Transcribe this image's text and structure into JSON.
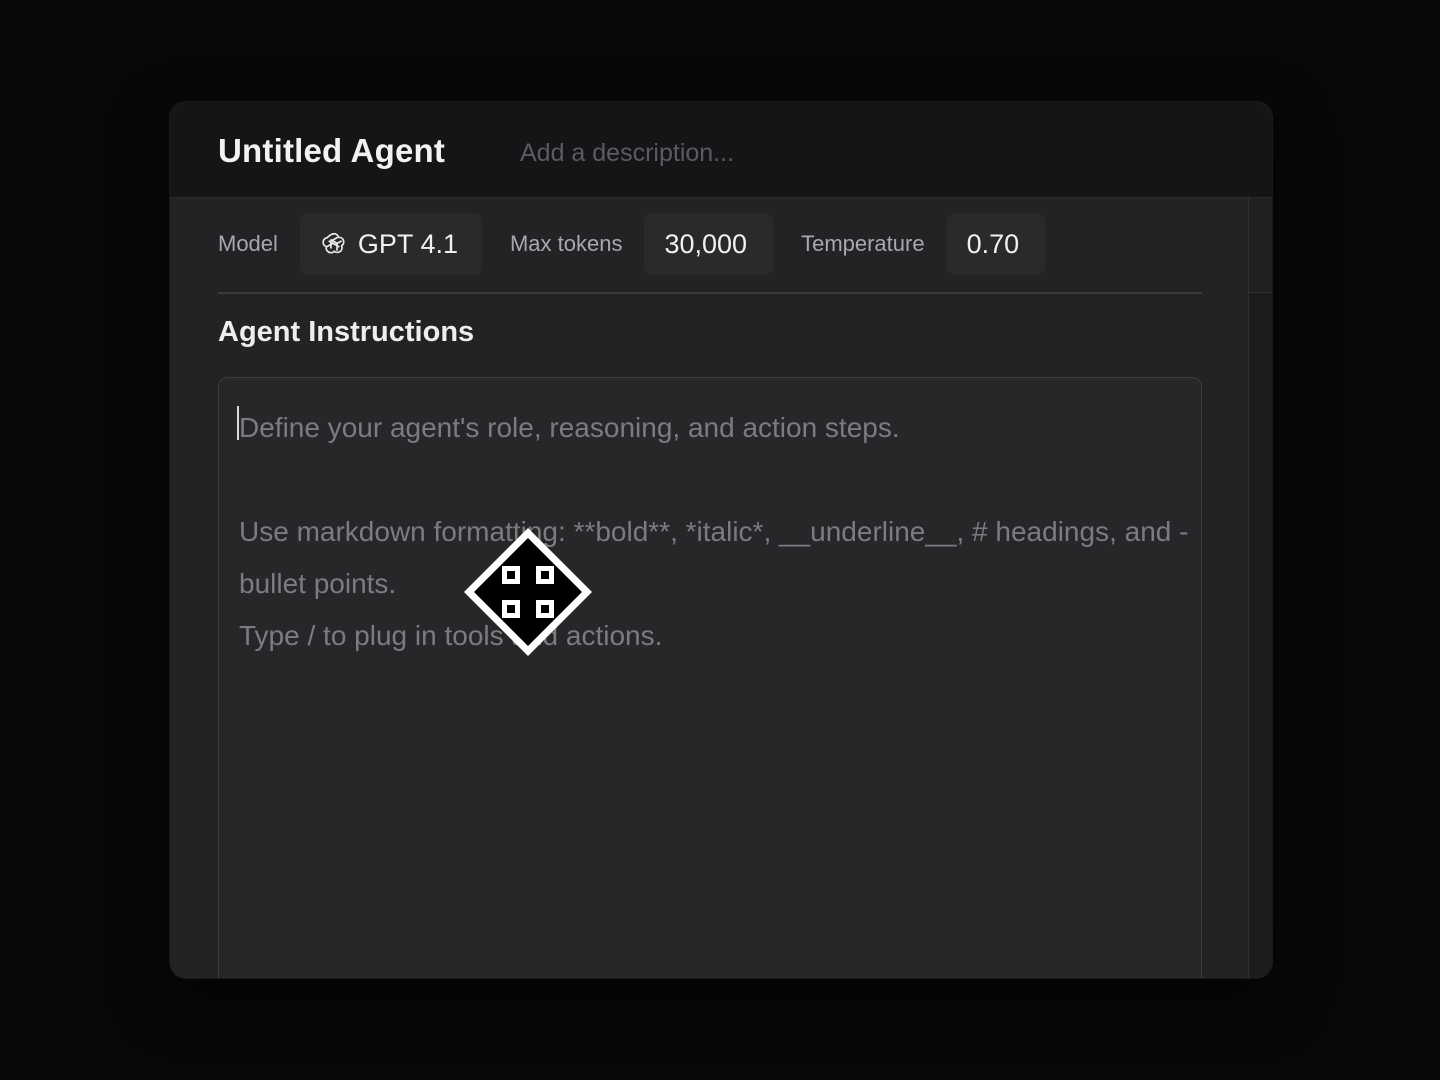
{
  "header": {
    "title": "Untitled Agent",
    "description_placeholder": "Add a description..."
  },
  "config": {
    "model_label": "Model",
    "model_value": "GPT 4.1",
    "model_icon": "openai-logo-icon",
    "max_tokens_label": "Max tokens",
    "max_tokens_value": "30,000",
    "temperature_label": "Temperature",
    "temperature_value": "0.70"
  },
  "instructions": {
    "title": "Agent Instructions",
    "placeholder_line1": "Define your agent's role, reasoning, and action steps.",
    "placeholder_line2": "Use markdown formatting: **bold**, *italic*, __underline__, # headings, and - bullet points.",
    "placeholder_line3": "Type / to plug in tools and actions."
  },
  "cursor": {
    "icon": "move-cursor-icon"
  }
}
